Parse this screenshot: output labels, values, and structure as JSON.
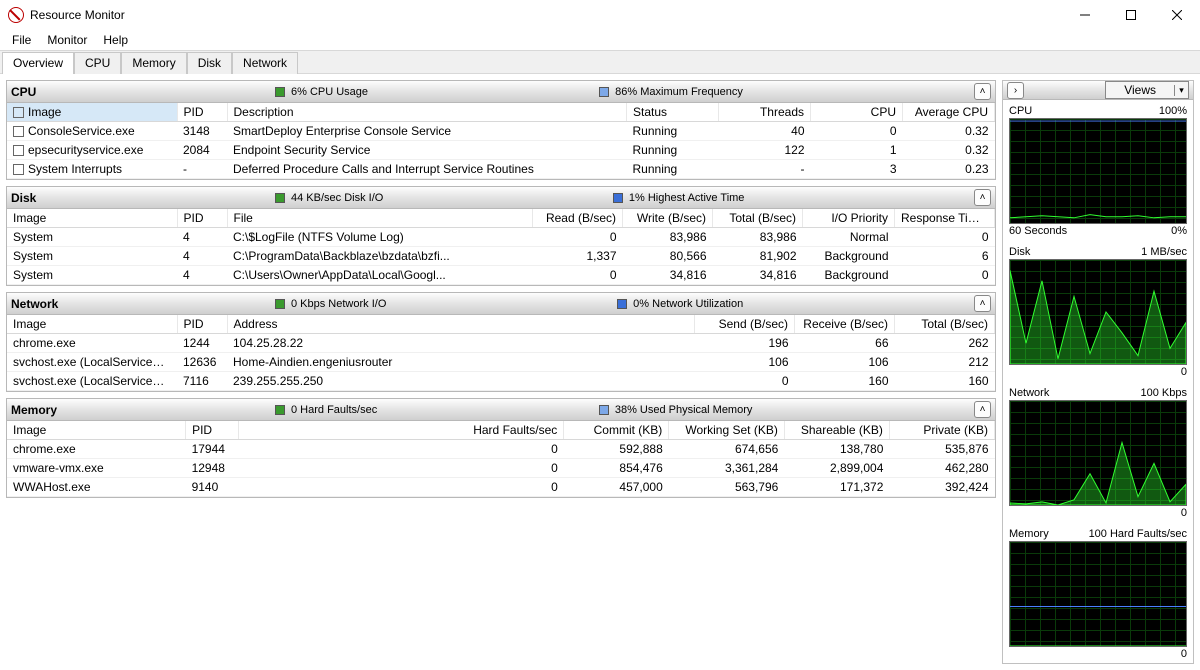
{
  "window": {
    "title": "Resource Monitor"
  },
  "menu": {
    "file": "File",
    "monitor": "Monitor",
    "help": "Help"
  },
  "tabs": {
    "overview": "Overview",
    "cpu": "CPU",
    "memory": "Memory",
    "disk": "Disk",
    "network": "Network"
  },
  "cpu": {
    "title": "CPU",
    "stat1": "6% CPU Usage",
    "stat2": "86% Maximum Frequency",
    "headers": {
      "image": "Image",
      "pid": "PID",
      "desc": "Description",
      "status": "Status",
      "threads": "Threads",
      "cpu": "CPU",
      "avg": "Average CPU"
    },
    "rows": [
      {
        "image": "ConsoleService.exe",
        "pid": "3148",
        "desc": "SmartDeploy Enterprise Console Service",
        "status": "Running",
        "threads": "40",
        "cpu": "0",
        "avg": "0.32"
      },
      {
        "image": "epsecurityservice.exe",
        "pid": "2084",
        "desc": "Endpoint Security Service",
        "status": "Running",
        "threads": "122",
        "cpu": "1",
        "avg": "0.32"
      },
      {
        "image": "System Interrupts",
        "pid": "-",
        "desc": "Deferred Procedure Calls and Interrupt Service Routines",
        "status": "Running",
        "threads": "-",
        "cpu": "3",
        "avg": "0.23"
      }
    ]
  },
  "disk": {
    "title": "Disk",
    "stat1": "44 KB/sec Disk I/O",
    "stat2": "1% Highest Active Time",
    "headers": {
      "image": "Image",
      "pid": "PID",
      "file": "File",
      "read": "Read (B/sec)",
      "write": "Write (B/sec)",
      "total": "Total (B/sec)",
      "prio": "I/O Priority",
      "resp": "Response Time ..."
    },
    "rows": [
      {
        "image": "System",
        "pid": "4",
        "file": "C:\\$LogFile (NTFS Volume Log)",
        "read": "0",
        "write": "83,986",
        "total": "83,986",
        "prio": "Normal",
        "resp": "0"
      },
      {
        "image": "System",
        "pid": "4",
        "file": "C:\\ProgramData\\Backblaze\\bzdata\\bzfi...",
        "read": "1,337",
        "write": "80,566",
        "total": "81,902",
        "prio": "Background",
        "resp": "6"
      },
      {
        "image": "System",
        "pid": "4",
        "file": "C:\\Users\\Owner\\AppData\\Local\\Googl...",
        "read": "0",
        "write": "34,816",
        "total": "34,816",
        "prio": "Background",
        "resp": "0"
      }
    ]
  },
  "network": {
    "title": "Network",
    "stat1": "0 Kbps Network I/O",
    "stat2": "0% Network Utilization",
    "headers": {
      "image": "Image",
      "pid": "PID",
      "addr": "Address",
      "send": "Send (B/sec)",
      "recv": "Receive (B/sec)",
      "total": "Total (B/sec)"
    },
    "rows": [
      {
        "image": "chrome.exe",
        "pid": "1244",
        "addr": "104.25.28.22",
        "send": "196",
        "recv": "66",
        "total": "262"
      },
      {
        "image": "svchost.exe (LocalServicePeerNet)",
        "pid": "12636",
        "addr": "Home-Aindien.engeniusrouter",
        "send": "106",
        "recv": "106",
        "total": "212"
      },
      {
        "image": "svchost.exe (LocalServiceAndNo...",
        "pid": "7116",
        "addr": "239.255.255.250",
        "send": "0",
        "recv": "160",
        "total": "160"
      }
    ]
  },
  "memory": {
    "title": "Memory",
    "stat1": "0 Hard Faults/sec",
    "stat2": "38% Used Physical Memory",
    "headers": {
      "image": "Image",
      "pid": "PID",
      "hf": "Hard Faults/sec",
      "commit": "Commit (KB)",
      "ws": "Working Set (KB)",
      "share": "Shareable (KB)",
      "priv": "Private (KB)"
    },
    "rows": [
      {
        "image": "chrome.exe",
        "pid": "17944",
        "hf": "0",
        "commit": "592,888",
        "ws": "674,656",
        "share": "138,780",
        "priv": "535,876"
      },
      {
        "image": "vmware-vmx.exe",
        "pid": "12948",
        "hf": "0",
        "commit": "854,476",
        "ws": "3,361,284",
        "share": "2,899,004",
        "priv": "462,280"
      },
      {
        "image": "WWAHost.exe",
        "pid": "9140",
        "hf": "0",
        "commit": "457,000",
        "ws": "563,796",
        "share": "171,372",
        "priv": "392,424"
      }
    ]
  },
  "sidebar": {
    "views": "Views",
    "charts": [
      {
        "title": "CPU",
        "right": "100%",
        "footerL": "60 Seconds",
        "footerR": "0%"
      },
      {
        "title": "Disk",
        "right": "1 MB/sec",
        "footerL": "",
        "footerR": "0"
      },
      {
        "title": "Network",
        "right": "100 Kbps",
        "footerL": "",
        "footerR": "0"
      },
      {
        "title": "Memory",
        "right": "100 Hard Faults/sec",
        "footerL": "",
        "footerR": "0"
      }
    ]
  },
  "chart_data": [
    {
      "type": "line",
      "title": "CPU",
      "ylim": [
        0,
        100
      ],
      "x_seconds": 60,
      "series": [
        {
          "name": "max_freq",
          "color": "#4a80ff",
          "values": [
            98,
            98,
            98,
            98,
            98,
            98,
            98,
            98,
            98,
            98,
            98,
            98
          ]
        },
        {
          "name": "cpu_usage",
          "color": "#30ff30",
          "values": [
            5,
            6,
            7,
            6,
            5,
            8,
            6,
            6,
            7,
            5,
            6,
            6
          ]
        }
      ]
    },
    {
      "type": "area",
      "title": "Disk",
      "ylim": [
        0,
        1000000
      ],
      "x_seconds": 60,
      "series": [
        {
          "name": "io",
          "color": "#30ff30",
          "values": [
            900000,
            200000,
            800000,
            50000,
            650000,
            100000,
            500000,
            300000,
            80000,
            700000,
            150000,
            400000
          ]
        }
      ]
    },
    {
      "type": "area",
      "title": "Network",
      "ylim": [
        0,
        100
      ],
      "x_seconds": 60,
      "series": [
        {
          "name": "kbps",
          "color": "#30ff30",
          "values": [
            2,
            1,
            3,
            0,
            5,
            30,
            2,
            60,
            8,
            40,
            3,
            20
          ]
        }
      ]
    },
    {
      "type": "line",
      "title": "Memory",
      "ylim": [
        0,
        100
      ],
      "x_seconds": 60,
      "series": [
        {
          "name": "used_pct",
          "color": "#4a80ff",
          "values": [
            38,
            38,
            38,
            38,
            38,
            38,
            38,
            38,
            38,
            38,
            38,
            38
          ]
        },
        {
          "name": "hard_faults",
          "color": "#30ff30",
          "values": [
            0,
            0,
            0,
            0,
            0,
            0,
            0,
            0,
            0,
            0,
            0,
            0
          ]
        }
      ]
    }
  ]
}
